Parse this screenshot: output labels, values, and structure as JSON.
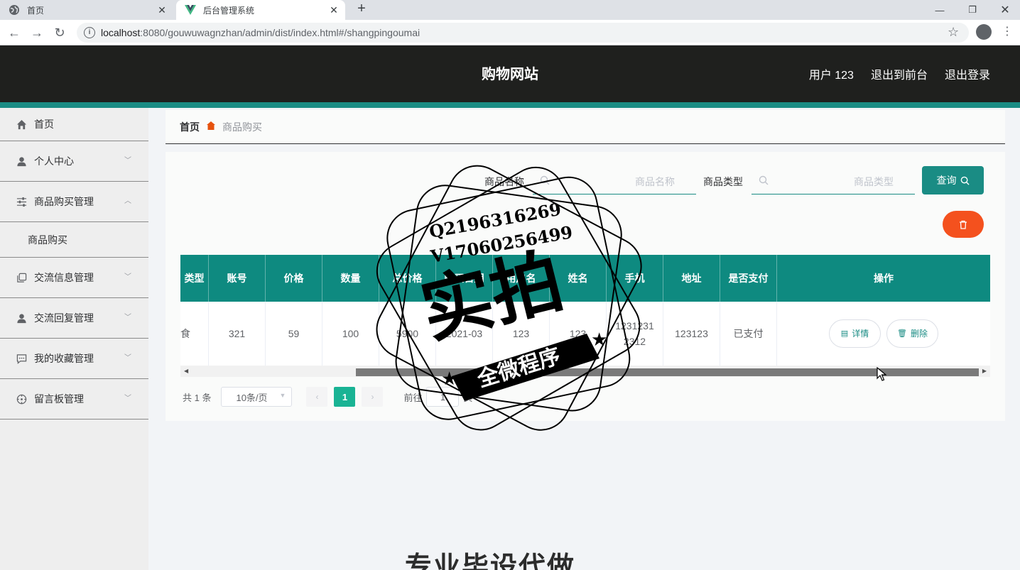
{
  "browser": {
    "tabs": [
      {
        "title": "首页",
        "icon": "globe-icon"
      },
      {
        "title": "后台管理系统",
        "icon": "vue-logo-icon"
      }
    ],
    "url_host": "localhost",
    "url_path": ":8080/gouwuwagnzhan/admin/dist/index.html#/shangpingoumai"
  },
  "header": {
    "title": "购物网站",
    "user": "用户 123",
    "to_front": "退出到前台",
    "logout": "退出登录"
  },
  "sidebar": {
    "items": [
      {
        "label": "首页",
        "icon": "home-icon"
      },
      {
        "label": "个人中心",
        "icon": "user-icon"
      },
      {
        "label": "商品购买管理",
        "icon": "sliders-icon"
      },
      {
        "label": "交流信息管理",
        "icon": "copy-icon"
      },
      {
        "label": "交流回复管理",
        "icon": "user-icon"
      },
      {
        "label": "我的收藏管理",
        "icon": "message-icon"
      },
      {
        "label": "留言板管理",
        "icon": "compass-icon"
      }
    ],
    "submenu_item": "商品购买"
  },
  "breadcrumb": {
    "home": "首页",
    "current": "商品购买"
  },
  "search": {
    "name_label": "商品名称",
    "name_placeholder": "商品名称",
    "type_label": "商品类型",
    "type_placeholder": "商品类型",
    "query_button": "查询"
  },
  "table": {
    "headers": [
      "类型",
      "账号",
      "价格",
      "数量",
      "总价格",
      "购买日期",
      "用户名",
      "姓名",
      "手机",
      "地址",
      "是否支付",
      "操作"
    ],
    "row": [
      "食",
      "321",
      "59",
      "100",
      "5900",
      "2021-03",
      "123",
      "123",
      "1231231 2312",
      "123123",
      "已支付"
    ],
    "detail_button": "详情",
    "delete_button": "删除"
  },
  "pager": {
    "total": "共 1 条",
    "page_size": "10条/页",
    "current_page": "1",
    "goto_label": "前往",
    "goto_value": "1",
    "page_unit": "页"
  },
  "watermark": {
    "qq": "Q2196316269",
    "wx": "V17060256499",
    "main": "实拍",
    "band": "全微程序",
    "footer": "专业毕设代做"
  },
  "colors": {
    "header_bg": "#1f201e",
    "accent": "#1a8c84",
    "danger": "#f4511e",
    "page_active": "#19b394"
  }
}
